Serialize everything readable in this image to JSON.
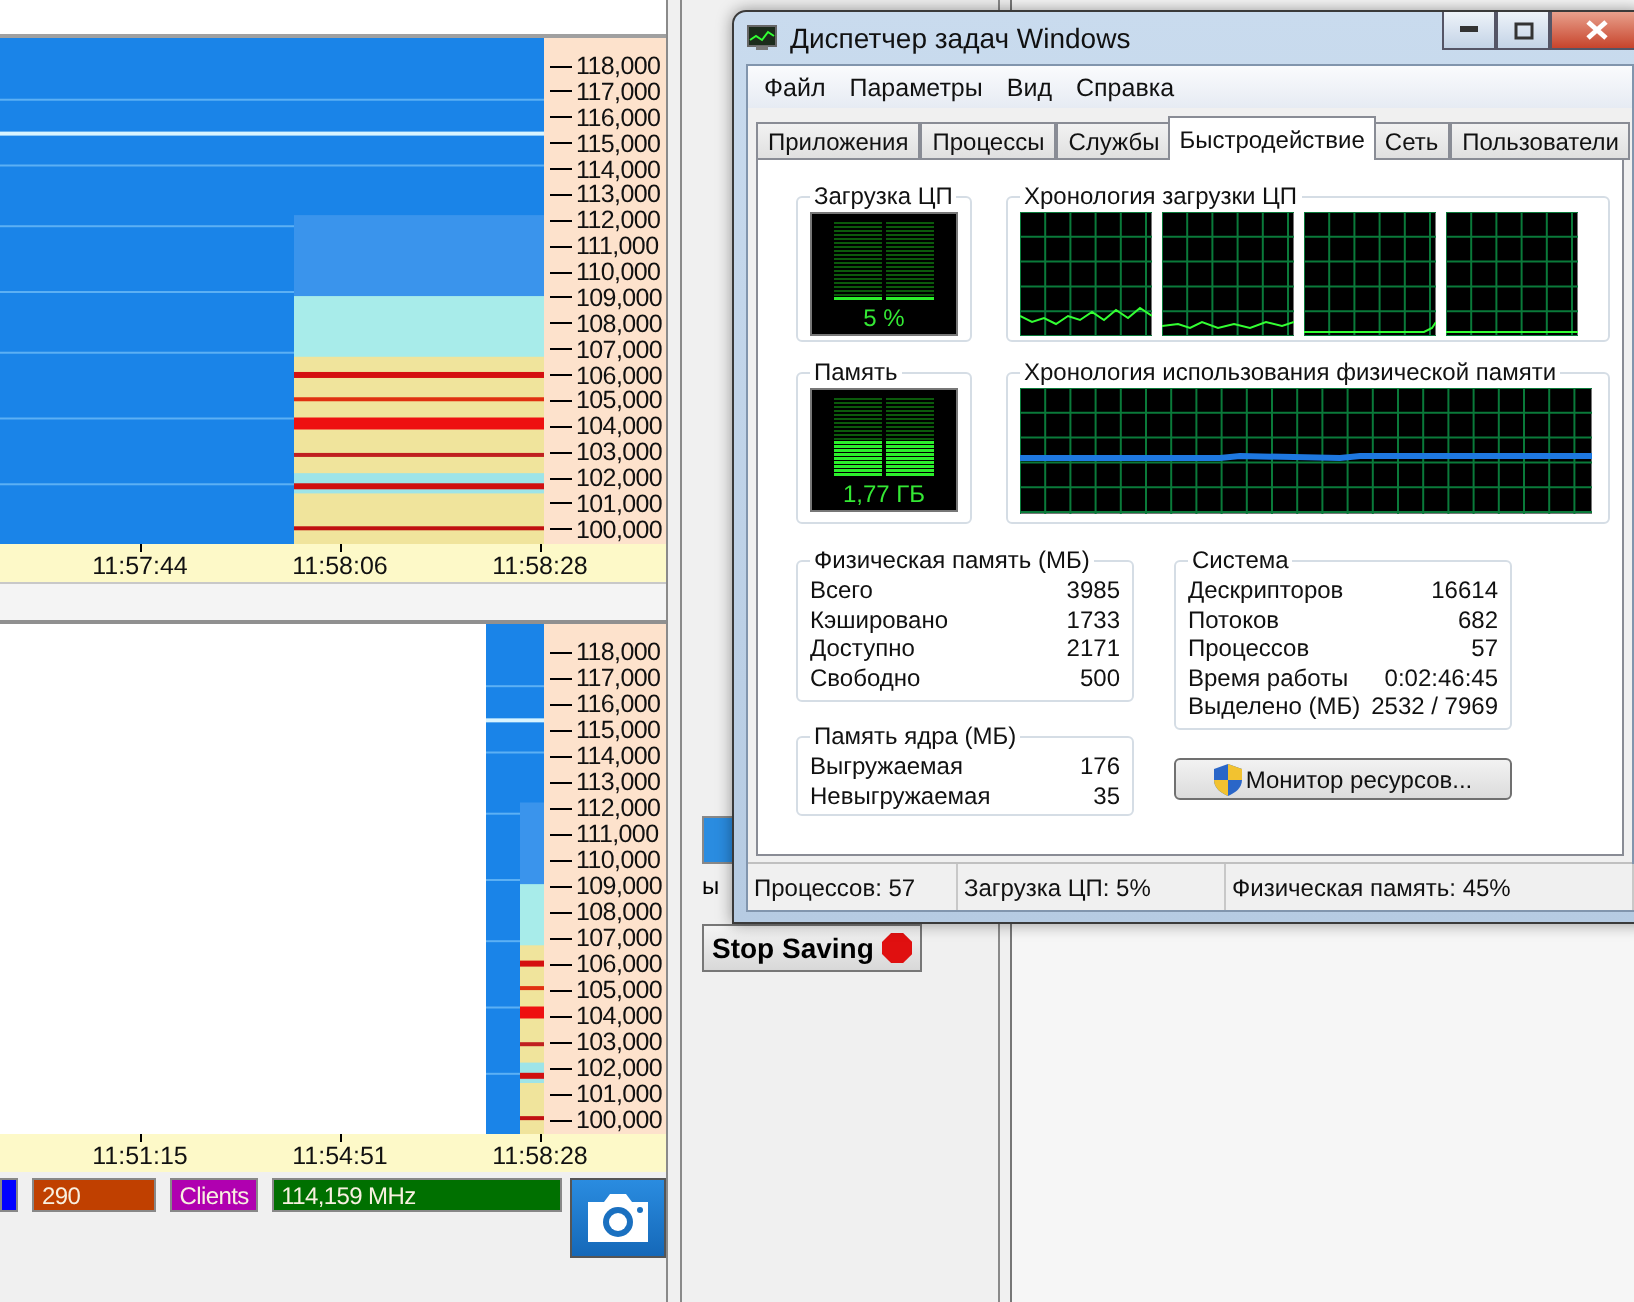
{
  "spectrum_panels": [
    {
      "kind": "full",
      "y_labels": [
        "118,000",
        "117,000",
        "116,000",
        "115,000",
        "114,000",
        "113,000",
        "112,000",
        "111,000",
        "110,000",
        "109,000",
        "108,000",
        "107,000",
        "106,000",
        "105,000",
        "104,000",
        "103,000",
        "102,000",
        "101,000",
        "100,000"
      ],
      "time_labels": [
        "11:57:44",
        "11:58:06",
        "11:58:28"
      ]
    },
    {
      "kind": "recent",
      "y_labels": [
        "118,000",
        "117,000",
        "116,000",
        "115,000",
        "114,000",
        "113,000",
        "112,000",
        "111,000",
        "110,000",
        "109,000",
        "108,000",
        "107,000",
        "106,000",
        "105,000",
        "104,000",
        "103,000",
        "102,000",
        "101,000",
        "100,000"
      ],
      "time_labels": [
        "11:51:15",
        "11:54:51",
        "11:58:28"
      ]
    }
  ],
  "readouts": [
    {
      "color": "#0000ff"
    },
    {
      "text": "290",
      "color": "#c04000"
    },
    {
      "text": "Clients",
      "color": "#b000b0"
    },
    {
      "text": "114,159 MHz",
      "color": "#007000"
    }
  ],
  "side_panel": {
    "fragment": "ы",
    "stop_button": "Stop Saving"
  },
  "task_manager": {
    "title": "Диспетчер задач Windows",
    "menu": [
      "Файл",
      "Параметры",
      "Вид",
      "Справка"
    ],
    "tabs": [
      {
        "label": "Приложения",
        "selected": false
      },
      {
        "label": "Процессы",
        "selected": false
      },
      {
        "label": "Службы",
        "selected": false
      },
      {
        "label": "Быстродействие",
        "selected": true
      },
      {
        "label": "Сеть",
        "selected": false
      },
      {
        "label": "Пользователи",
        "selected": false
      }
    ],
    "cpu": {
      "title": "Загрузка ЦП",
      "reading": "5 %",
      "level": 0.05
    },
    "cpu_history": {
      "title": "Хронология загрузки ЦП"
    },
    "memory": {
      "title": "Память",
      "reading": "1,77 ГБ",
      "level": 0.45
    },
    "memory_history": {
      "title": "Хронология использования физической памяти"
    },
    "physical_memory": {
      "title": "Физическая память (МБ)",
      "rows": [
        {
          "label": "Всего",
          "value": "3985"
        },
        {
          "label": "Кэшировано",
          "value": "1733"
        },
        {
          "label": "Доступно",
          "value": "2171"
        },
        {
          "label": "Свободно",
          "value": "500"
        }
      ]
    },
    "kernel_memory": {
      "title": "Память ядра (МБ)",
      "rows": [
        {
          "label": "Выгружаемая",
          "value": "176"
        },
        {
          "label": "Невыгружаемая",
          "value": "35"
        }
      ]
    },
    "system": {
      "title": "Система",
      "rows": [
        {
          "label": "Дескрипторов",
          "value": "16614"
        },
        {
          "label": "Потоков",
          "value": "682"
        },
        {
          "label": "Процессов",
          "value": "57"
        },
        {
          "label": "Время работы",
          "value": "0:02:46:45"
        },
        {
          "label": "Выделено (МБ)",
          "value": "2532 / 7969"
        }
      ]
    },
    "resource_monitor_button": "Монитор ресурсов...",
    "status_bar": [
      "Процессов: 57",
      "Загрузка ЦП: 5%",
      "Физическая память: 45%"
    ]
  }
}
